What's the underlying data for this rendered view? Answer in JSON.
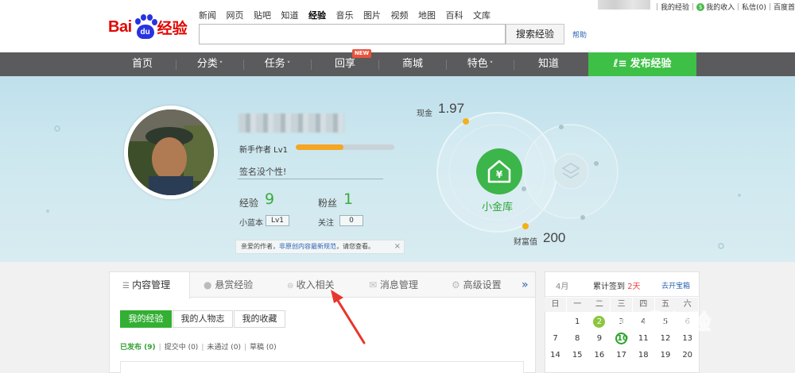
{
  "header": {
    "logo": {
      "bai": "Bai",
      "du": "du",
      "jy": "经验"
    },
    "nav": [
      "新闻",
      "网页",
      "贴吧",
      "知道",
      "经验",
      "音乐",
      "图片",
      "视频",
      "地图",
      "百科",
      "文库"
    ],
    "active_nav": "经验",
    "search_button": "搜索经验",
    "help": "帮助",
    "user_links": [
      "我的经验",
      "我的收入",
      "私信(0)",
      "百度首页"
    ]
  },
  "navbar": {
    "items": [
      "首页",
      "分类",
      "任务",
      "回享",
      "商城",
      "特色",
      "知道"
    ],
    "new_badge": "NEW",
    "publish": "发布经验",
    "caret": "˅"
  },
  "profile": {
    "level_label": "新手作者 Lv1",
    "level_progress": 0.48,
    "signature": "签名没个性!",
    "exp_label": "经验",
    "exp_value": "9",
    "fans_label": "粉丝",
    "fans_value": "1",
    "xiaolanben_label": "小蓝本",
    "xiaolanben_value": "Lv1",
    "follow_label": "关注",
    "follow_value": "0",
    "notice_prefix": "亲爱的作者，",
    "notice_link": "非原创内容最新规范",
    "notice_suffix": "，请您查看。",
    "notice_close": "×"
  },
  "vault": {
    "cash_label": "现金",
    "cash_value": "1.97",
    "vault_label": "小金库",
    "vault_icon": "¥",
    "wealth_label": "财富值",
    "wealth_value": "200"
  },
  "content": {
    "tabs": [
      "内容管理",
      "悬赏经验",
      "收入相关",
      "消息管理",
      "高级设置"
    ],
    "more": "»",
    "subtabs": [
      "我的经验",
      "我的人物志",
      "我的收藏"
    ],
    "status": {
      "published": "已发布",
      "published_count": "(9)",
      "submitting": "提交中 (0)",
      "rejected": "未通过 (0)",
      "draft": "草稿 (0)"
    }
  },
  "calendar": {
    "month": "4月",
    "sign_prefix": "累计签到",
    "sign_days": "2天",
    "link": "去开宝箱",
    "weekdays": [
      "日",
      "一",
      "二",
      "三",
      "四",
      "五",
      "六"
    ],
    "rows": [
      [
        "",
        "",
        "",
        "",
        "",
        "",
        ""
      ],
      [
        "",
        "1",
        "2",
        "3",
        "4",
        "5",
        "6"
      ],
      [
        "7",
        "8",
        "9",
        "10",
        "11",
        "12",
        "13"
      ],
      [
        "14",
        "15",
        "16",
        "17",
        "18",
        "19",
        "20"
      ]
    ]
  },
  "colors": {
    "accent_green": "#3ec046",
    "brand_red": "#e10601",
    "brand_blue": "#2932e1",
    "nav_gray": "#5b5b5d",
    "arrow_red": "#e8362d"
  }
}
